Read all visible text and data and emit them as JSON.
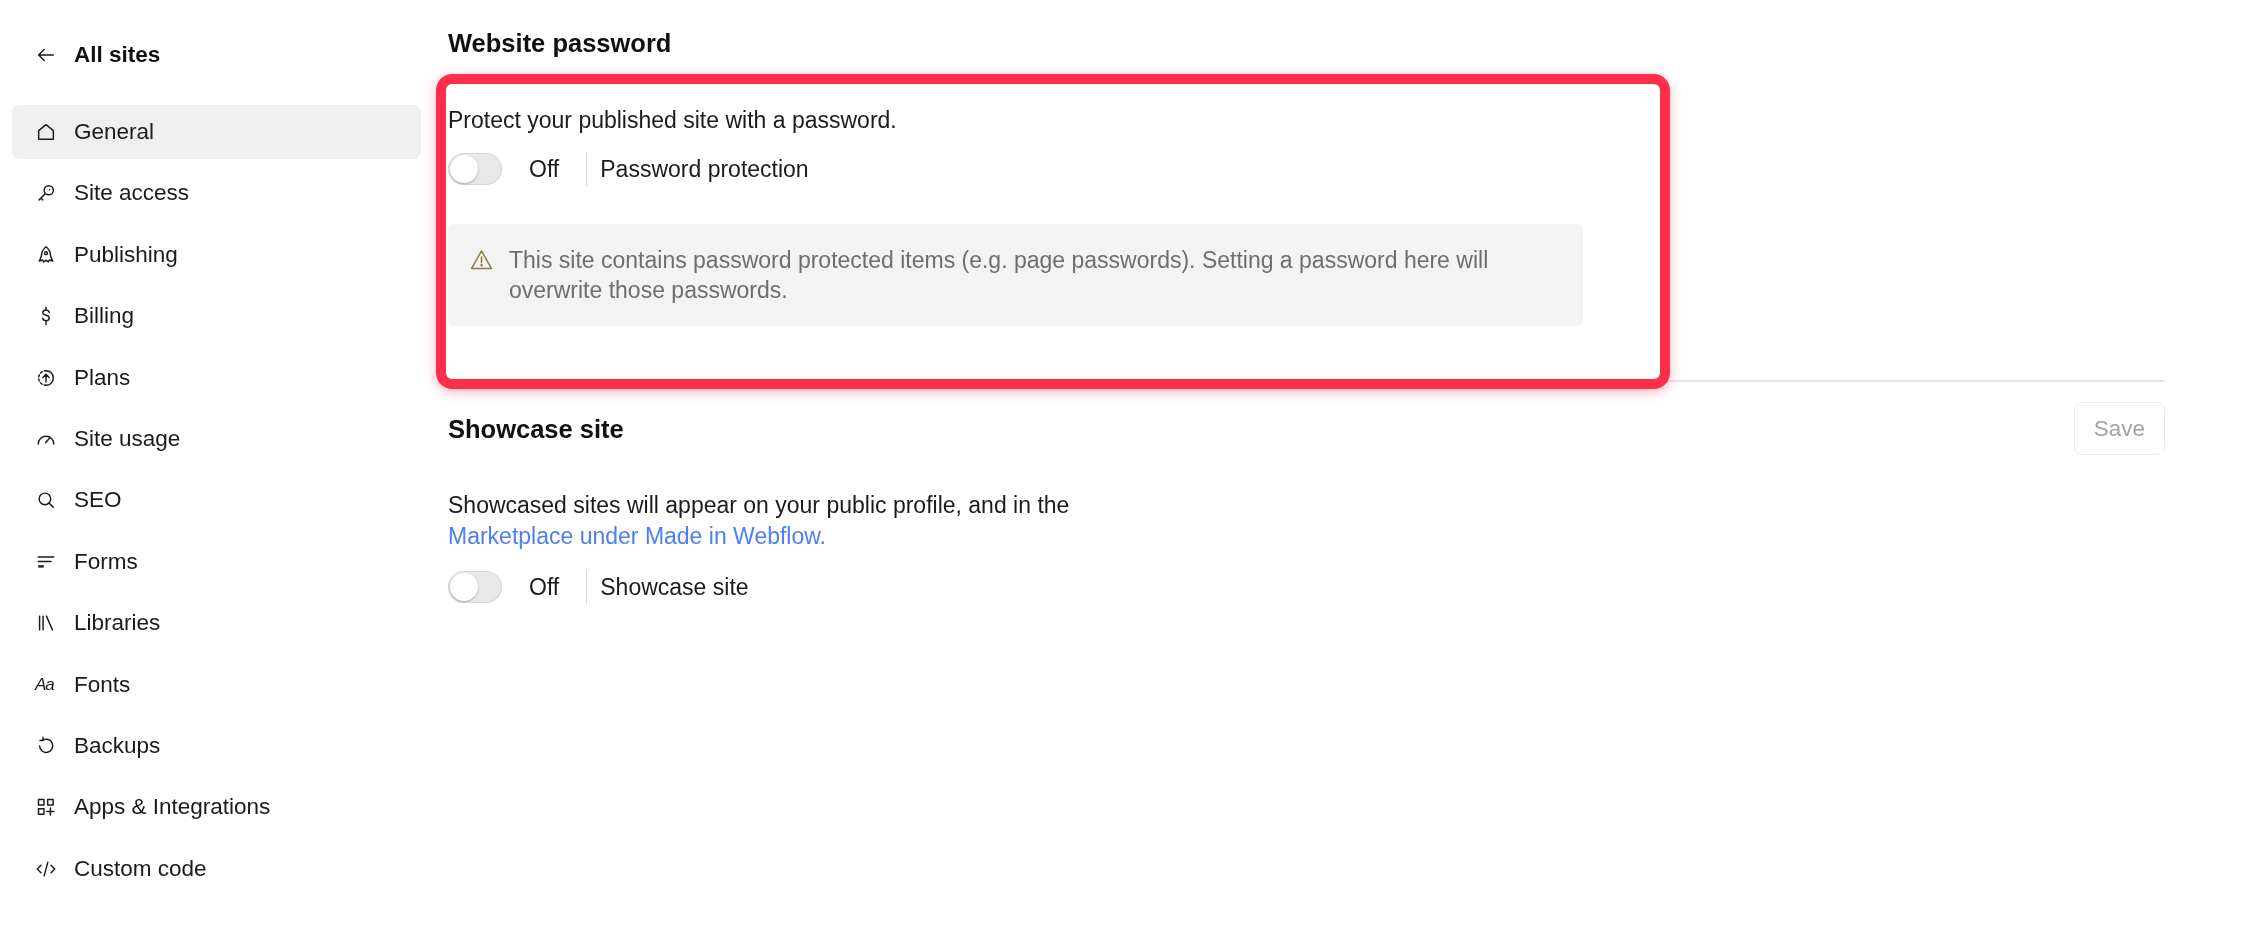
{
  "sidebar": {
    "back_link": {
      "label": "All sites"
    },
    "items": [
      {
        "label": "General",
        "selected": true
      },
      {
        "label": "Site access",
        "selected": false
      },
      {
        "label": "Publishing",
        "selected": false
      },
      {
        "label": "Billing",
        "selected": false
      },
      {
        "label": "Plans",
        "selected": false
      },
      {
        "label": "Site usage",
        "selected": false
      },
      {
        "label": "SEO",
        "selected": false
      },
      {
        "label": "Forms",
        "selected": false
      },
      {
        "label": "Libraries",
        "selected": false
      },
      {
        "label": "Fonts",
        "selected": false,
        "icon_glyph": "Aa"
      },
      {
        "label": "Backups",
        "selected": false
      },
      {
        "label": "Apps & Integrations",
        "selected": false
      },
      {
        "label": "Custom code",
        "selected": false
      }
    ]
  },
  "website_password": {
    "title": "Website password",
    "highlighted": true,
    "description": "Protect your published site with a password.",
    "toggle": {
      "on": false,
      "state_label": "Off",
      "label": "Password protection"
    },
    "warning": {
      "text": "This site contains password protected items (e.g. page passwords). Setting a password here will overwrite those passwords."
    }
  },
  "showcase": {
    "title": "Showcase site",
    "save_button": {
      "label": "Save",
      "disabled": true
    },
    "description": {
      "text": "Showcased sites will appear on your public profile, and in the ",
      "link": "Marketplace under Made in Webflow."
    },
    "toggle": {
      "on": false,
      "state_label": "Off",
      "label": "Showcase site"
    }
  }
}
